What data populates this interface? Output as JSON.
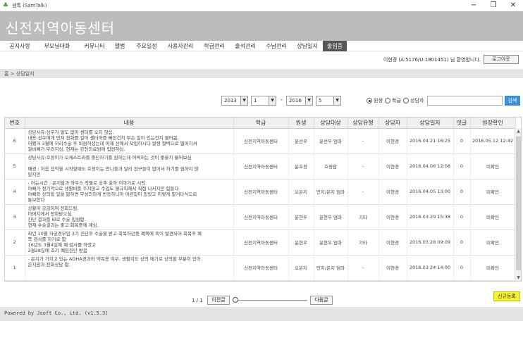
{
  "window": {
    "title": "샘톡 (SamTalk)",
    "icon": "leaf-icon",
    "minimize": "−",
    "maximize": "❐",
    "close": "✕"
  },
  "header": {
    "brand": "신전지역아동센터"
  },
  "nav": {
    "items": [
      "공지사항",
      "부모님대화",
      "커뮤니티",
      "앨범",
      "주요일정",
      "사용자관리",
      "학급관리",
      "출석관리",
      "수납관리",
      "상담일지",
      "출입증"
    ],
    "active_index": 10
  },
  "userbar": {
    "welcome": "이현경 (A:5176/U:1801451) 님 환영합니다.",
    "logout": "로그아웃"
  },
  "breadcrumb": "홈 > 상담일지",
  "filter": {
    "from_year": "2013",
    "from_month": "1",
    "dash": "-",
    "to_year": "2016",
    "to_month": "5",
    "radios": [
      "원생",
      "학급",
      "상담자"
    ],
    "radio_selected": 0,
    "search_placeholder": "",
    "search_button": "검색"
  },
  "table": {
    "headers": [
      "번호",
      "내용",
      "학급",
      "원생",
      "상담대상",
      "상담유형",
      "상담자",
      "상담일자",
      "댓글",
      "원장확인"
    ],
    "rows": [
      {
        "no": "6",
        "content": "상담사유:선우가 말도 없이 센터를 오지 않음.\n내용:선우에게 먼저 전화를 걸어 센터까를 빠진건지 무슨 일이 있는건지 물어봄.\n어쨌거 3월에 허리수술 후 퇴원하셨는데 어제 산에서 작업하시다 쌀쟁 절벽으로 떨어지셔\n갈비뼈가 부러지심, 현재는 강진의료원에 입원하심.",
        "class": "신전지역아동센터",
        "student": "윤선우",
        "target": "윤선우 엄마",
        "type": "-",
        "counselor": "이현경",
        "date": "2016.04.21 16:25",
        "comments": "0",
        "confirm": "2016.05.12 12:42"
      },
      {
        "no": "5",
        "content": "상담사유:호정이가 오케스트라를 중단하기를 원하는데 어떡하는 것이 좋을지 물어보심\n\n배경 : 처음 음악을 시작할때도 호정이는 언니들과 달리 친구들이 없어서 하기를 원하지 않\n았지만",
        "class": "신전지역아동센터",
        "student": "윤호정",
        "target": "호정맘",
        "type": "-",
        "counselor": "이현경",
        "date": "2016.04.06 12:08",
        "comments": "0",
        "confirm": "미확인"
      },
      {
        "no": "4",
        "content": "- 어는시간 : 은지맘과 하우스 작물로 상추 출하 이야기로 시작\n  아빠가 정기적으로 생활비를 주지않고 수입도 불규칙해서 직접 나서지만 힘들다\n  아빠와 상의할 일을 말하면 무성의하게 반응하니까 이런일이 있었고 이렇게 말거다식으로\n통보한다",
        "class": "신전지역아동센터",
        "student": "오은지",
        "target": "민지/은지 엄마",
        "type": "-",
        "counselor": "이현경",
        "date": "2016.04.05 13:00",
        "comments": "0",
        "confirm": "미확인"
      },
      {
        "no": "3",
        "content": "상황이 궁금하여 전화드림.\n아버지께서 전화받으심.\n진단 결과를 바로 수술 입원함.\n현재 수술결과는 좋고 회복중에 계심.",
        "class": "신전지역아동센터",
        "student": "윤현우",
        "target": "윤현우 엄마",
        "type": "기타",
        "counselor": "이현경",
        "date": "2016.03.29 15:38",
        "comments": "0",
        "confirm": "미확인"
      },
      {
        "no": "2",
        "content": "작년 10월 자궁경부암 3기 진단후 수술을 받고 회복하던중 폐쪽에 혹이 발견되어 회복후 폐\n쪽 검사를 하기로 함\n16년도 3월4일에 폐  검사를 하였고\n3월28일에 조기 폐암진단 받음",
        "class": "신전지역아동센터",
        "student": "윤현우",
        "target": "윤현우 엄마",
        "type": "기타",
        "counselor": "이현경",
        "date": "2016.03.28 09:09",
        "comments": "0",
        "confirm": "미확인"
      },
      {
        "no": "1",
        "content": "- 은지가 가지고 있는 ADHA경과와 약복용 여부, 생활지도 상의 애기로 상의할 부분이 있어\n은지맘과 전화상담 함.",
        "class": "신전지역아동센터",
        "student": "오은지",
        "target": "민지/은지 엄마",
        "type": "-",
        "counselor": "이현경",
        "date": "2016.03.24 14:00",
        "comments": "0",
        "confirm": "미확인"
      }
    ]
  },
  "pager": {
    "info": "1 / 1",
    "prev": "이전글",
    "next": "다음글",
    "position": 0
  },
  "new_button": "신규등록",
  "footer": "Powered by Jsoft Co., Ltd. (v1.5.3)"
}
